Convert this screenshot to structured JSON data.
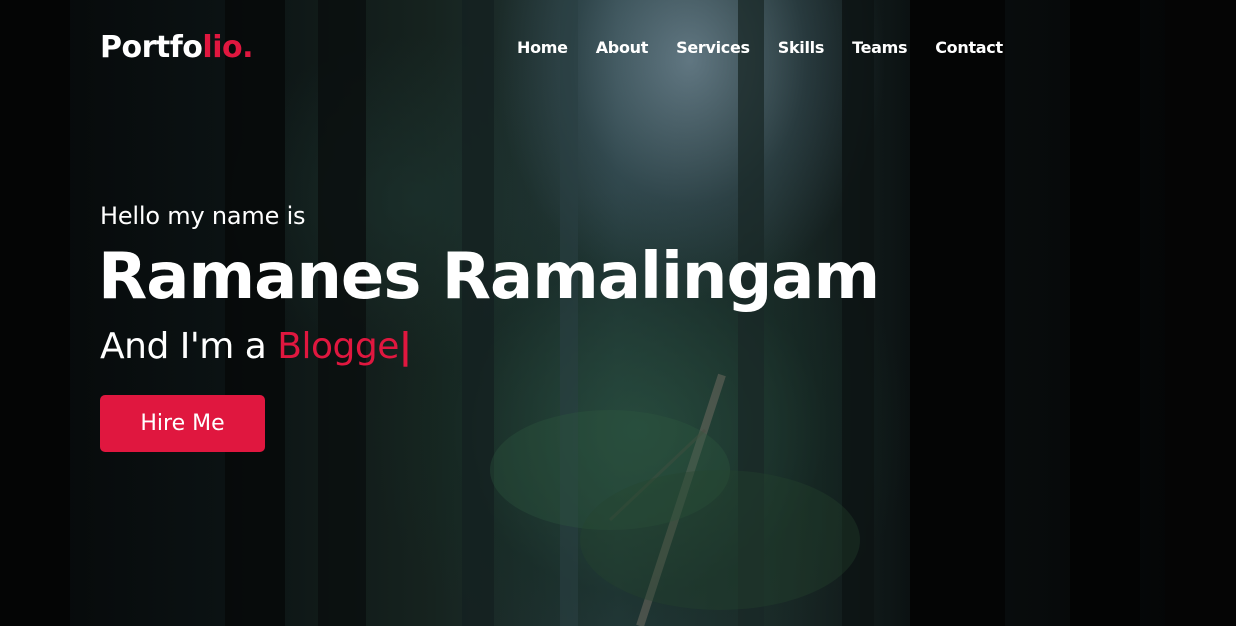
{
  "header": {
    "logo_main": "Portfo",
    "logo_accent": "lio.",
    "nav": [
      "Home",
      "About",
      "Services",
      "Skills",
      "Teams",
      "Contact"
    ]
  },
  "hero": {
    "intro": "Hello my name is",
    "name": "Ramanes Ramalingam",
    "role_prefix": "And I'm a ",
    "role_typed": "Blogge",
    "cursor": "|",
    "cta_label": "Hire Me"
  },
  "colors": {
    "accent": "#e0173f",
    "text": "#ffffff",
    "background": "#050607"
  }
}
